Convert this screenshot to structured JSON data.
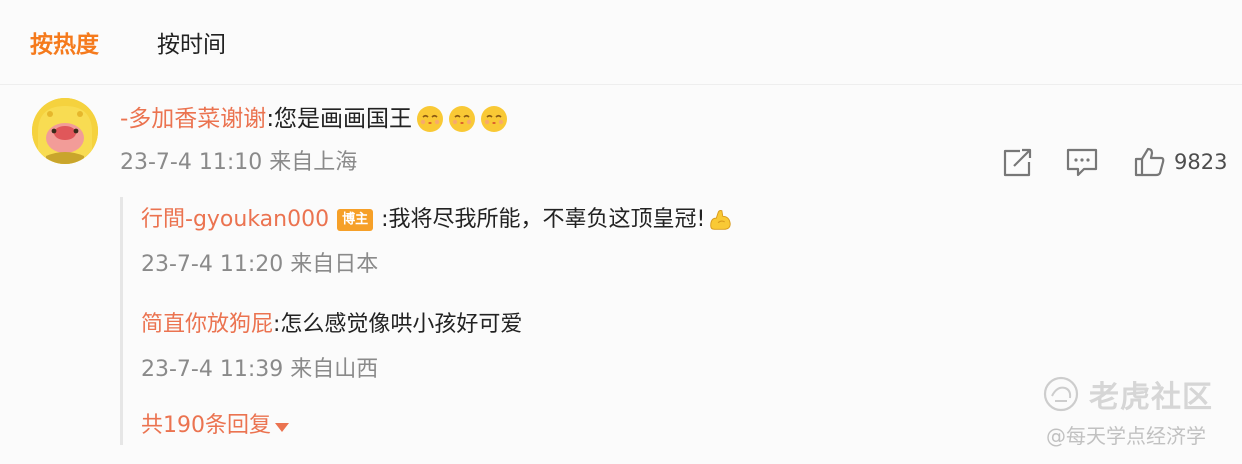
{
  "tabs": {
    "hot": "按热度",
    "time": "按时间"
  },
  "comment": {
    "username": "-多加香菜谢谢",
    "text": ":您是画画国王",
    "emoji_icon": "kiss-face-emoji",
    "emoji_count": 3,
    "time": "23-7-4 11:10",
    "location": "来自上海",
    "likes": "9823",
    "icons": [
      "share-icon",
      "comment-icon",
      "like-icon"
    ]
  },
  "replies": [
    {
      "username": "行間-gyoukan000",
      "badge": "博主",
      "text": ":我将尽我所能，不辜负这顶皇冠!",
      "emoji_icon": "muscle-emoji",
      "time": "23-7-4 11:20",
      "location": "来自日本"
    },
    {
      "username": "简直你放狗屁",
      "text": ":怎么感觉像哄小孩好可爱",
      "time": "23-7-4 11:39",
      "location": "来自山西"
    }
  ],
  "more_replies": "共190条回复",
  "watermark": {
    "brand": "老虎社区",
    "sub": "@每天学点经济学"
  },
  "colors": {
    "accent": "#f57a1c",
    "username": "#eb7350",
    "badge": "#f6a028",
    "meta": "#8a8a8a"
  }
}
